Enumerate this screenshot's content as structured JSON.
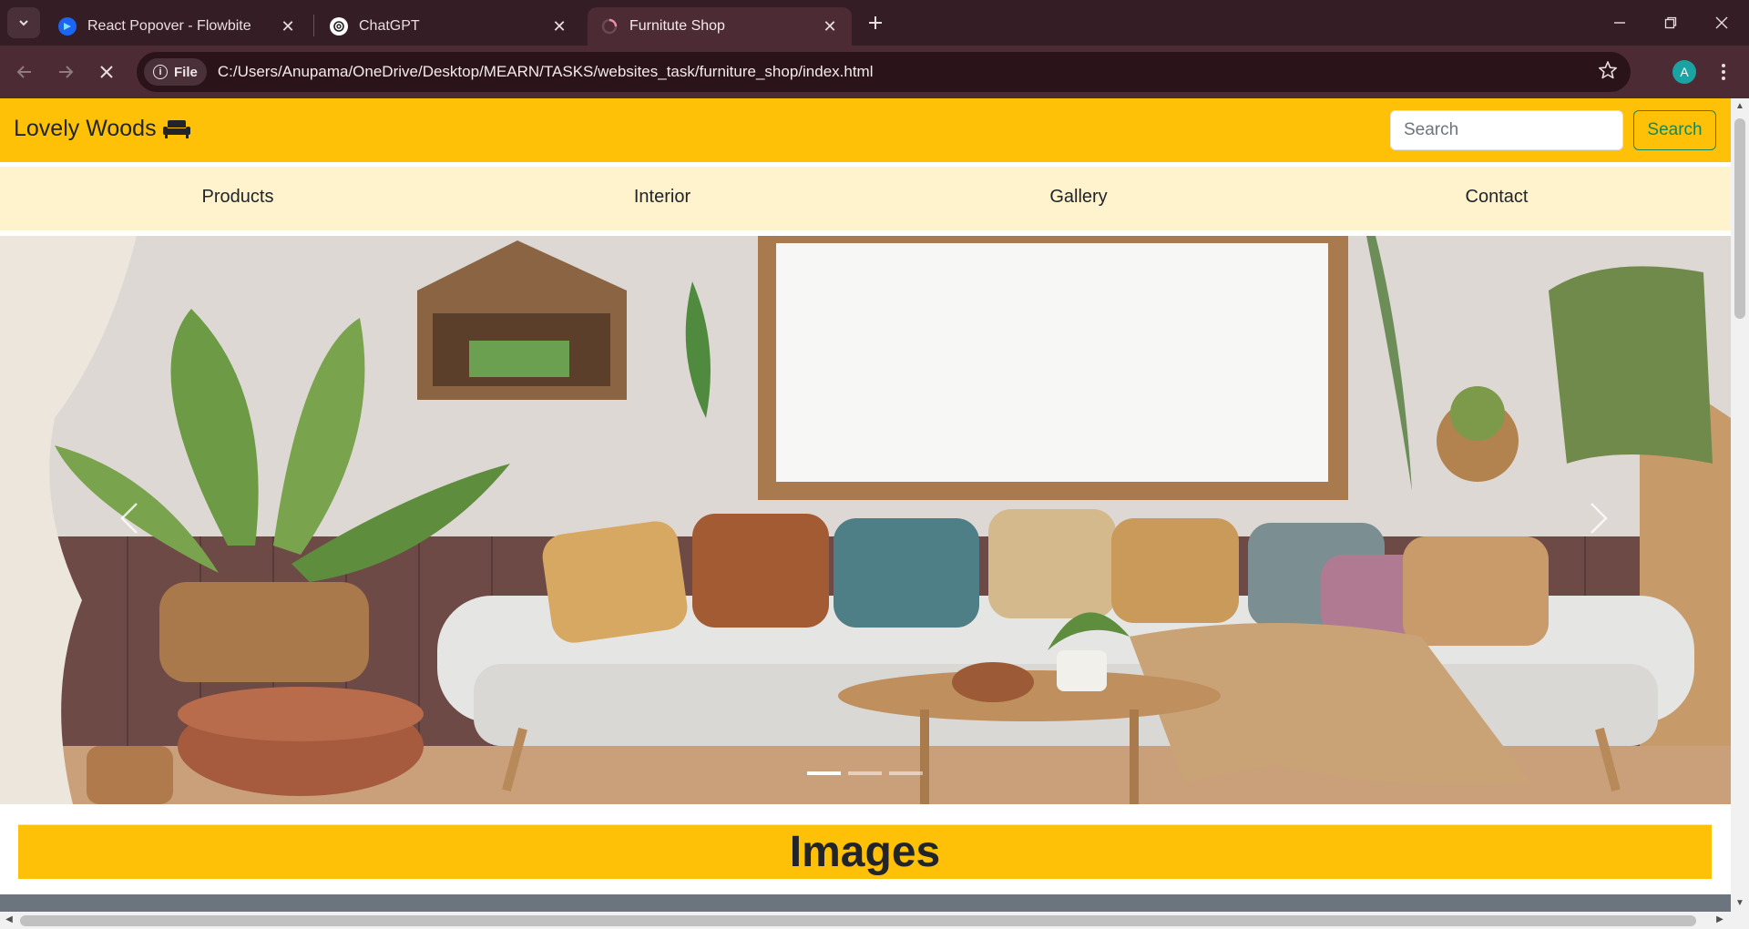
{
  "browser": {
    "tabs": [
      {
        "title": "React Popover - Flowbite",
        "icon": "flowbite-icon",
        "active": false
      },
      {
        "title": "ChatGPT",
        "icon": "chatgpt-icon",
        "active": false
      },
      {
        "title": "Furnitute Shop",
        "icon": "loading-spinner-icon",
        "active": true
      }
    ],
    "omnibox": {
      "chip_label": "File",
      "url": "C:/Users/Anupama/OneDrive/Desktop/MEARN/TASKS/websites_task/furniture_shop/index.html"
    },
    "profile_initial": "A",
    "colors": {
      "tabstrip": "#351d25",
      "toolbar": "#4d2b35",
      "avatar": "#1ba3a3"
    }
  },
  "page": {
    "navbar": {
      "brand": "Lovely Woods",
      "brand_icon": "couch-icon",
      "search_placeholder": "Search",
      "search_button": "Search",
      "colors": {
        "background": "#ffc107",
        "button": "#198754"
      }
    },
    "menu": {
      "items": [
        "Products",
        "Interior",
        "Gallery",
        "Contact"
      ],
      "background": "#fff3cd"
    },
    "carousel": {
      "slide_count": 3,
      "active_index": 0,
      "prev_icon": "chevron-left-icon",
      "next_icon": "chevron-right-icon"
    },
    "section": {
      "heading": "Images"
    }
  }
}
